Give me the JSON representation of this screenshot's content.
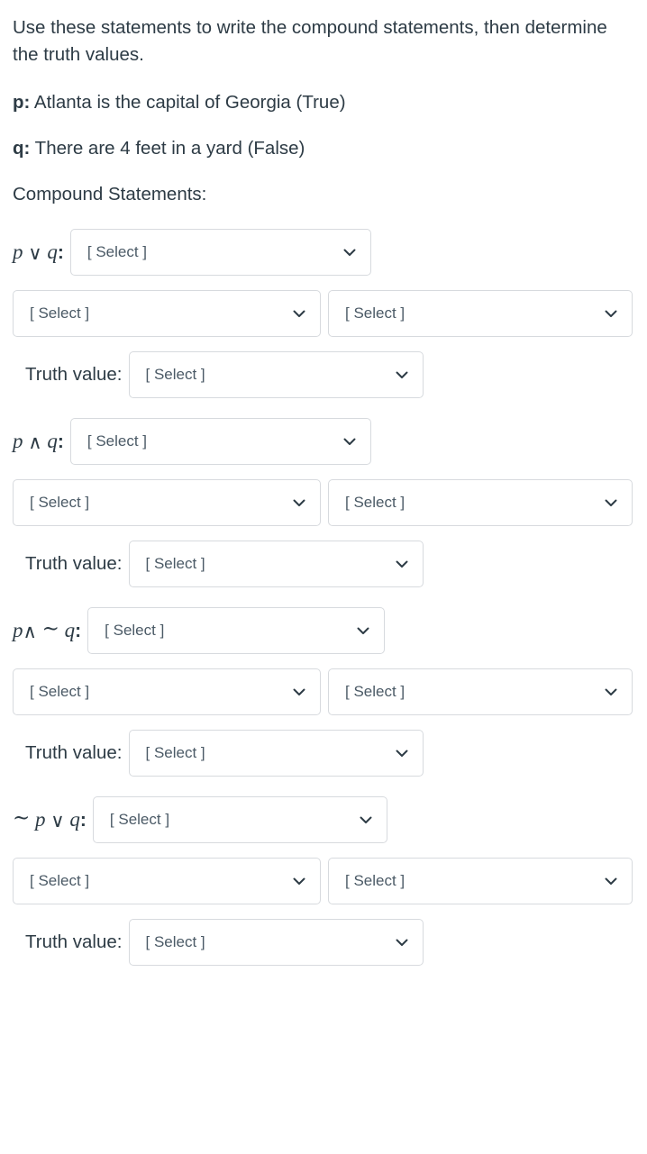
{
  "instructions": {
    "line1": "Use these statements to write the compound statements, then determine the truth values."
  },
  "premises": [
    {
      "key": "p:",
      "text": " Atlanta is the capital of Georgia (True)"
    },
    {
      "key": "q:",
      "text": " There are 4 feet in a yard (False)"
    }
  ],
  "section_heading": "Compound Statements:",
  "labels": {
    "truth_value": "Truth value:"
  },
  "select_placeholder": "[ Select ]",
  "colors": {
    "text": "#2d3b45",
    "border": "#d7dade",
    "placeholder": "#4b5a66",
    "background": "#ffffff"
  },
  "questions": [
    {
      "id": "p-or-q",
      "expression": {
        "parts": [
          {
            "t": "p",
            "style": "var"
          },
          {
            "t": "∨",
            "style": "op"
          },
          {
            "t": "q",
            "style": "var"
          },
          {
            "t": ":",
            "style": "colon"
          }
        ],
        "plain": "p ∨ q:"
      },
      "statement_select": "[ Select ]",
      "part_selects": [
        "[ Select ]",
        "[ Select ]"
      ],
      "truth_label": "Truth value:",
      "truth_select": "[ Select ]"
    },
    {
      "id": "p-and-q",
      "expression": {
        "parts": [
          {
            "t": "p",
            "style": "var"
          },
          {
            "t": "∧",
            "style": "op"
          },
          {
            "t": "q",
            "style": "var"
          },
          {
            "t": ":",
            "style": "colon"
          }
        ],
        "plain": "p ∧ q:"
      },
      "statement_select": "[ Select ]",
      "part_selects": [
        "[ Select ]",
        "[ Select ]"
      ],
      "truth_label": "Truth value:",
      "truth_select": "[ Select ]"
    },
    {
      "id": "p-and-not-q",
      "expression": {
        "parts": [
          {
            "t": "p",
            "style": "var"
          },
          {
            "t": "∧",
            "style": "op-tight"
          },
          {
            "t": "∼",
            "style": "tilde"
          },
          {
            "t": "q",
            "style": "var"
          },
          {
            "t": ":",
            "style": "colon"
          }
        ],
        "plain": "p∧ ∼ q:"
      },
      "statement_select": "[ Select ]",
      "part_selects": [
        "[ Select ]",
        "[ Select ]"
      ],
      "truth_label": "Truth value:",
      "truth_select": "[ Select ]"
    },
    {
      "id": "not-p-or-q",
      "expression": {
        "parts": [
          {
            "t": "∼",
            "style": "tilde"
          },
          {
            "t": "p",
            "style": "var"
          },
          {
            "t": "∨",
            "style": "op"
          },
          {
            "t": "q",
            "style": "var"
          },
          {
            "t": ":",
            "style": "colon"
          }
        ],
        "plain": "∼ p ∨ q:"
      },
      "statement_select": "[ Select ]",
      "part_selects": [
        "[ Select ]",
        "[ Select ]"
      ],
      "truth_label": "Truth value:",
      "truth_select": "[ Select ]"
    }
  ]
}
